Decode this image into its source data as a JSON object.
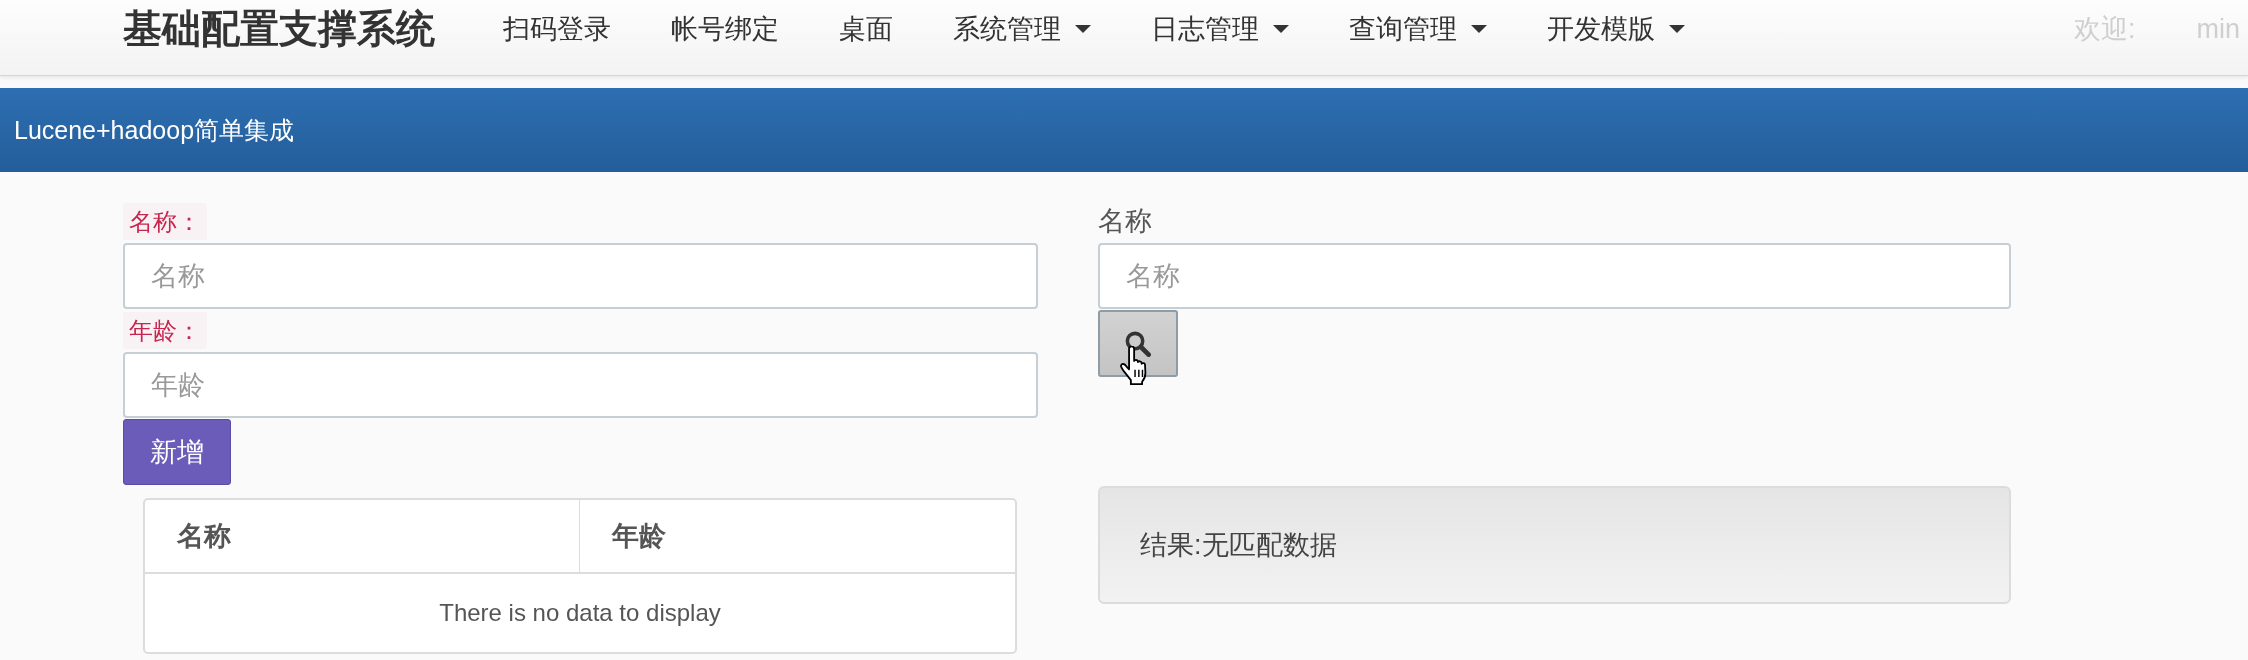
{
  "navbar": {
    "brand": "基础配置支撑系统",
    "items": [
      {
        "label": "扫码登录",
        "dropdown": false
      },
      {
        "label": "帐号绑定",
        "dropdown": false
      },
      {
        "label": "桌面",
        "dropdown": false
      },
      {
        "label": "系统管理",
        "dropdown": true
      },
      {
        "label": "日志管理",
        "dropdown": true
      },
      {
        "label": "查询管理",
        "dropdown": true
      },
      {
        "label": "开发模版",
        "dropdown": true
      }
    ],
    "welcome": "欢迎:",
    "user": "min"
  },
  "page_header": {
    "title": "Lucene+hadoop简单集成"
  },
  "add_form": {
    "fields": [
      {
        "label": "名称：",
        "placeholder": "名称"
      },
      {
        "label": "年龄：",
        "placeholder": "年龄"
      }
    ],
    "submit": "新增"
  },
  "table": {
    "columns": [
      "名称",
      "年龄"
    ],
    "empty_message": "There is no data to display"
  },
  "search_form": {
    "label": "名称",
    "placeholder": "名称"
  },
  "result": {
    "text": "结果:无匹配数据"
  }
}
